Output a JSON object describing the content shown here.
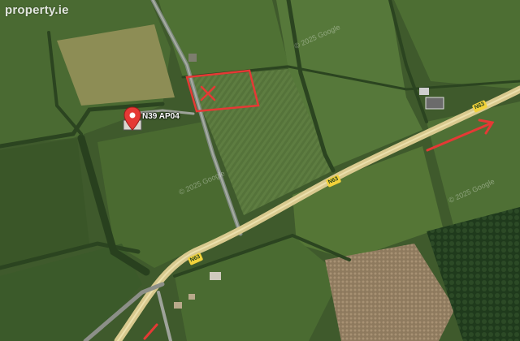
{
  "watermark": "property.ie",
  "pin": {
    "label": "N39 AP04",
    "color": "#e53935"
  },
  "road_labels": [
    "N63",
    "N63",
    "N63"
  ],
  "copyright": [
    "© 2025 Google",
    "© 2025 Google",
    "© 2025 Google"
  ],
  "colors": {
    "field_dark": "#3f5a2c",
    "field_light": "#5b7a3a",
    "road": "#d8c98e",
    "boundary": "#e53935",
    "arrow": "#e53935",
    "bog": "#9b8466"
  }
}
